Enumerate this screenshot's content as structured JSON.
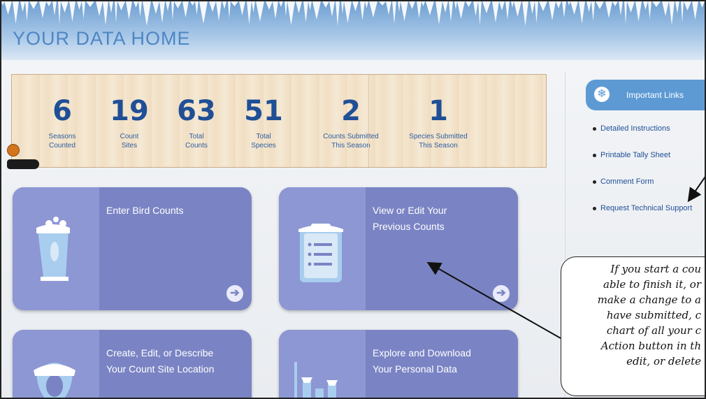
{
  "header": {
    "title": "YOUR DATA HOME"
  },
  "stats": [
    {
      "value": "6",
      "label_line1": "Seasons",
      "label_line2": "Counted"
    },
    {
      "value": "19",
      "label_line1": "Count",
      "label_line2": "Sites"
    },
    {
      "value": "63",
      "label_line1": "Total",
      "label_line2": "Counts"
    },
    {
      "value": "51",
      "label_line1": "Total",
      "label_line2": "Species"
    },
    {
      "value": "2",
      "label_line1": "Counts Submitted",
      "label_line2": "This Season"
    },
    {
      "value": "1",
      "label_line1": "Species Submitted",
      "label_line2": "This Season"
    }
  ],
  "tiles": {
    "enter": {
      "label_line1": "Enter Bird Counts",
      "label_line2": ""
    },
    "view": {
      "label_line1": "View or Edit Your",
      "label_line2": "Previous Counts"
    },
    "create": {
      "label_line1": "Create, Edit, or Describe",
      "label_line2": "Your Count Site Location"
    },
    "explore": {
      "label_line1": "Explore and Download",
      "label_line2": "Your Personal Data"
    },
    "arrow_glyph": "➔"
  },
  "sidebar": {
    "important_links_label": "Important Links",
    "links": [
      "Detailed Instructions",
      "Printable Tally Sheet",
      "Comment Form",
      "Request Technical Support"
    ]
  },
  "callout": {
    "lines": [
      "If you start a cou",
      "able to finish it, or",
      "make a change to a",
      "have submitted, c",
      "chart of all your c",
      "Action button in th",
      "edit, or delete"
    ]
  },
  "colors": {
    "tile": "#7a84c4",
    "accent": "#5d9ad4",
    "stat_number": "#1f4f96"
  }
}
